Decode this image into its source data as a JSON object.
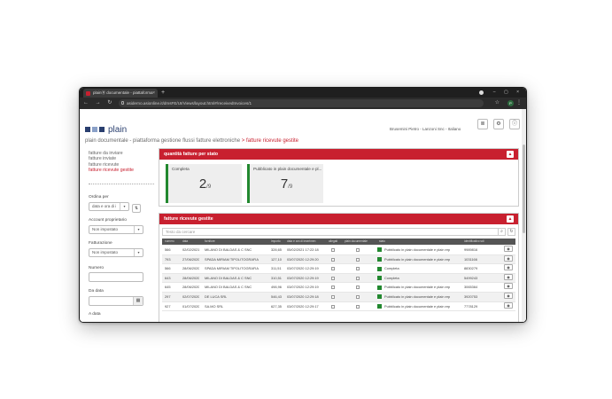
{
  "browser": {
    "tab_title": "plainⓇ documentale - piattaforma",
    "url": "asiderno.asionline.it/dmsFE/UI/Views/layout.html#/receivedInvoices/1"
  },
  "header": {
    "logo_text": "plain",
    "user_line": "Brusemini Pietro  -  Lanzoni Snc  -  Italiano",
    "breadcrumb_root": "plain documentale - piattaforma gestione flussi fatture elettroniche",
    "breadcrumb_sep": ">",
    "breadcrumb_current": "fatture ricevute gestite"
  },
  "sidebar": {
    "links": [
      "fatture da inviare",
      "fatture inviate",
      "fatture ricevute",
      "fatture ricevute gestite"
    ],
    "order_label": "Ordina per",
    "order_value": "data e ora di i",
    "owner_label": "Account proprietario",
    "owner_value": "Non impostato",
    "billing_label": "Fatturazione",
    "billing_value": "Non impostato",
    "number_label": "Numero",
    "from_label": "Da data",
    "to_label": "A data"
  },
  "stats": {
    "title": "quantità fatture per stato",
    "cards": [
      {
        "label": "Completa",
        "count": "2",
        "total": "/9"
      },
      {
        "label": "Pubblicato in plain documentale e pl...",
        "count": "7",
        "total": "/9"
      }
    ]
  },
  "invoices": {
    "title": "fatture ricevute gestite",
    "search_placeholder": "Testo da cercare",
    "columns": [
      "numero",
      "data",
      "fornitore",
      "importo",
      "data e ora di inserimen",
      "allegati",
      "plain documentale",
      "stato",
      "identificativo sdi"
    ],
    "rows": [
      {
        "numero": "566",
        "data": "02/02/2021",
        "fornitore": "MILANO DI BALDAS & C SNC",
        "importo": "328,65",
        "inserimento": "05/02/2021 17:22:18",
        "stato": "Pubblicato in plain documentale e plain erp",
        "sdi": "9989816"
      },
      {
        "numero": "793",
        "data": "27/06/2020",
        "fornitore": "SPADA MIRIAM TIPOLITOGRAFIA",
        "importo": "127,10",
        "inserimento": "03/07/2020 12:29:20",
        "stato": "Pubblicato in plain documentale e plain erp",
        "sdi": "1031166"
      },
      {
        "numero": "566",
        "data": "28/06/2020",
        "fornitore": "SPADA MIRIAM TIPOLITOGRAFIA",
        "importo": "311,51",
        "inserimento": "03/07/2020 12:29:19",
        "stato": "Completa",
        "sdi": "8830279"
      },
      {
        "numero": "643",
        "data": "28/06/2020",
        "fornitore": "MILANO DI BALDAS & C SNC",
        "importo": "310,51",
        "inserimento": "03/07/2020 12:29:19",
        "stato": "Completa",
        "sdi": "5499243"
      },
      {
        "numero": "645",
        "data": "28/06/2020",
        "fornitore": "MILANO DI BALDAS & C SNC",
        "importo": "498,96",
        "inserimento": "03/07/2020 12:29:19",
        "stato": "Pubblicato in plain documentale e plain erp",
        "sdi": "3065364"
      },
      {
        "numero": "297",
        "data": "02/07/2020",
        "fornitore": "DE LUCA SRL",
        "importo": "546,43",
        "inserimento": "03/07/2020 12:29:18",
        "stato": "Pubblicato in plain documentale e plain erp",
        "sdi": "3920753"
      },
      {
        "numero": "927",
        "data": "01/07/2020",
        "fornitore": "SA.MO SRL",
        "importo": "627,35",
        "inserimento": "03/07/2020 12:29:17",
        "stato": "Pubblicato in plain documentale e plain erp",
        "sdi": "7778129"
      }
    ]
  },
  "colors": {
    "brand_red": "#c8202f",
    "status_green": "#22882f",
    "logo_blue": "#2a3f6f"
  }
}
